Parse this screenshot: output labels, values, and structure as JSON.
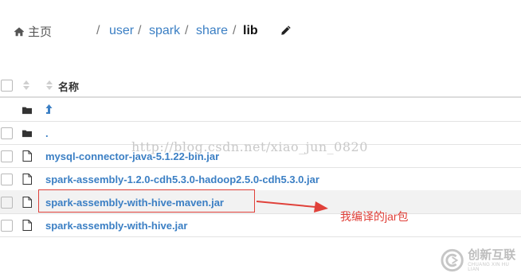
{
  "breadcrumb": {
    "home_label": "主页",
    "items": [
      "user",
      "spark",
      "share"
    ],
    "current": "lib",
    "separator": "/"
  },
  "table": {
    "header": {
      "name_label": "名称"
    },
    "rows": [
      {
        "type": "folder",
        "name": "",
        "icon": "parent-directory-arrow"
      },
      {
        "type": "folder",
        "name": "."
      },
      {
        "type": "file",
        "name": "mysql-connector-java-5.1.22-bin.jar"
      },
      {
        "type": "file",
        "name": "spark-assembly-1.2.0-cdh5.3.0-hadoop2.5.0-cdh5.3.0.jar"
      },
      {
        "type": "file",
        "name": "spark-assembly-with-hive-maven.jar"
      },
      {
        "type": "file",
        "name": "spark-assembly-with-hive.jar"
      }
    ]
  },
  "watermark": "http://blog.csdn.net/xiao_jun_0820",
  "annotation": {
    "text": "我编译的jar包",
    "color": "#e0413a"
  },
  "logo": {
    "text_cn": "创新互联",
    "text_en": "CHUANG XIN HU LIAN"
  },
  "colors": {
    "link": "#3b7fc4",
    "highlight_row": "#f2f2f2"
  }
}
